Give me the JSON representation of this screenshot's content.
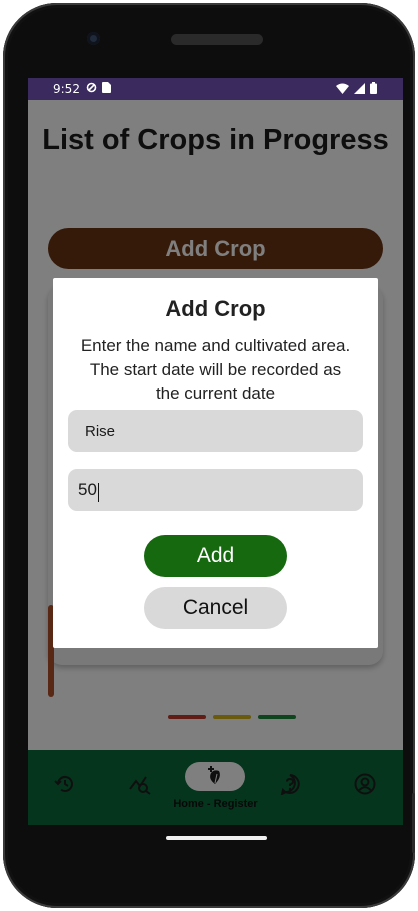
{
  "status_bar": {
    "time": "9:52"
  },
  "page": {
    "title": "List of Crops in Progress",
    "add_crop_button": "Add Crop"
  },
  "dialog": {
    "title": "Add Crop",
    "message": "Enter the name and cultivated area. The start date will be recorded as the current date",
    "name_field_value": "Rise",
    "area_field_value": "50",
    "add_button": "Add",
    "cancel_button": "Cancel"
  },
  "bottom_nav": {
    "items": [
      {
        "icon": "history-icon"
      },
      {
        "icon": "analytics-search-icon"
      },
      {
        "icon": "plant-add-icon",
        "label": "Home - Register",
        "selected": true
      },
      {
        "icon": "help-icon"
      },
      {
        "icon": "account-icon"
      }
    ]
  },
  "colors": {
    "status_bar": "#3a2a5e",
    "add_crop_bar": "#6b3312",
    "nav_bar": "#0b6a3b",
    "add_button": "#16690f",
    "cancel_button": "#d9d9d9",
    "field_bg": "#d9d9d9"
  }
}
